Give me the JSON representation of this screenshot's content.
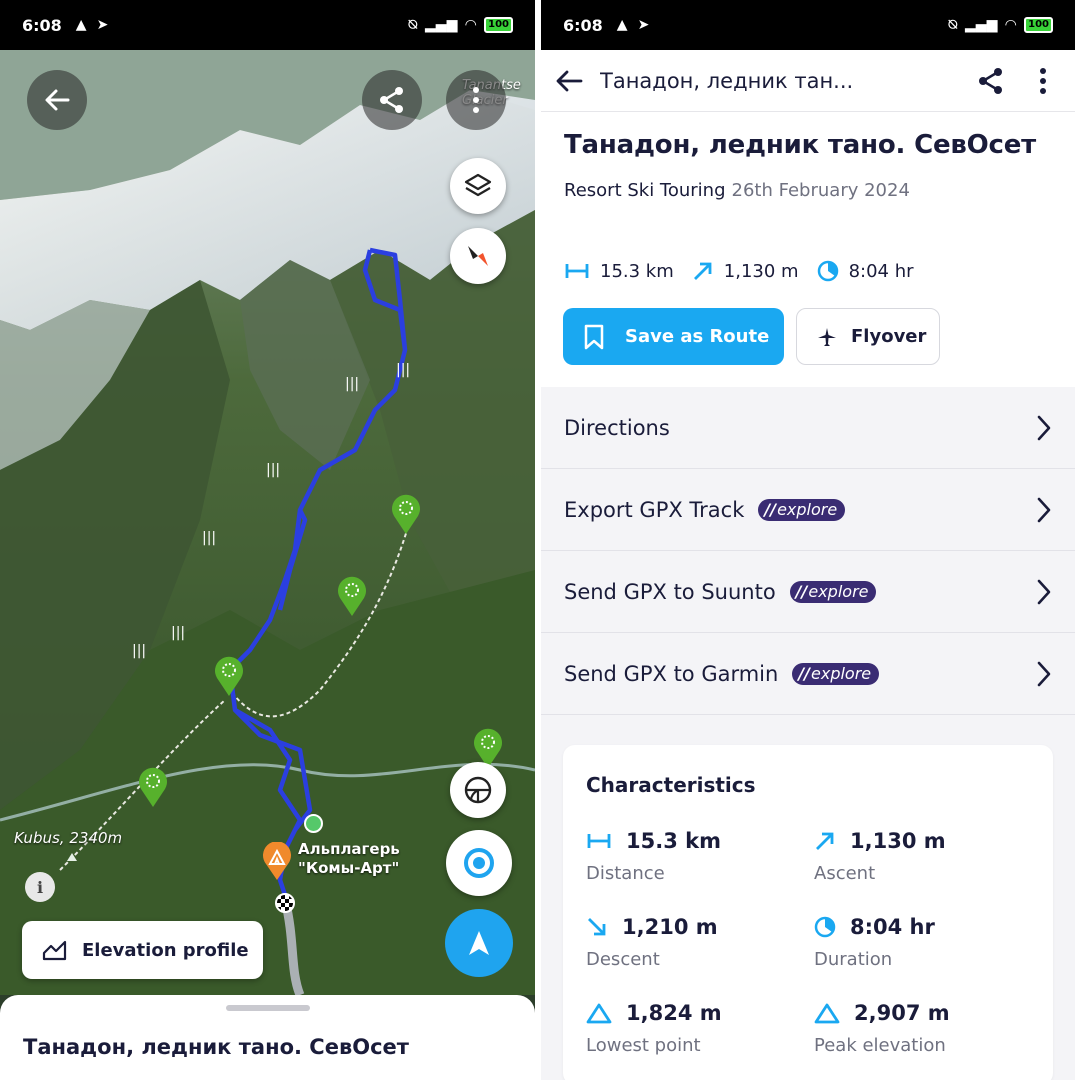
{
  "left": {
    "status_bar": {
      "time": "6:08",
      "battery": "100"
    },
    "map": {
      "labels": {
        "glacier": "Tanantse Glacier",
        "kubus": "Kubus, 2340m",
        "camp_line1": "Альплагерь",
        "camp_line2": "\"Комы-Арт\""
      }
    },
    "elevation_button_label": "Elevation profile",
    "sheet_title": "Танадон, ледник тано. СевОсет"
  },
  "right": {
    "status_bar": {
      "time": "6:08",
      "battery": "100"
    },
    "appbar_title": "Танадон, ледник тан...",
    "title": "Танадон, ледник тано. СевОсет",
    "activity": "Resort Ski Touring",
    "date": "26th February 2024",
    "stats": {
      "distance": "15.3 km",
      "ascent": "1,130 m",
      "duration": "8:04 hr"
    },
    "save_button_label": "Save as Route",
    "flyover_button_label": "Flyover",
    "list": [
      {
        "label": "Directions",
        "badge": ""
      },
      {
        "label": "Export GPX Track",
        "badge": "explore"
      },
      {
        "label": "Send GPX to Suunto",
        "badge": "explore"
      },
      {
        "label": "Send GPX to Garmin",
        "badge": "explore"
      }
    ],
    "characteristics": {
      "title": "Characteristics",
      "items": [
        {
          "value": "15.3 km",
          "label": "Distance",
          "icon": "distance-icon"
        },
        {
          "value": "1,130 m",
          "label": "Ascent",
          "icon": "ascent-icon"
        },
        {
          "value": "1,210 m",
          "label": "Descent",
          "icon": "descent-icon"
        },
        {
          "value": "8:04 hr",
          "label": "Duration",
          "icon": "duration-icon"
        },
        {
          "value": "1,824 m",
          "label": "Lowest point",
          "icon": "lowest-point-icon"
        },
        {
          "value": "2,907 m",
          "label": "Peak elevation",
          "icon": "peak-elevation-icon"
        }
      ]
    }
  },
  "colors": {
    "accent_blue": "#1aa8f1",
    "track_blue": "#2b3fe0",
    "badge_purple": "#3a2c73",
    "text_dark": "#1a1c3a",
    "text_muted": "#6f7180"
  }
}
